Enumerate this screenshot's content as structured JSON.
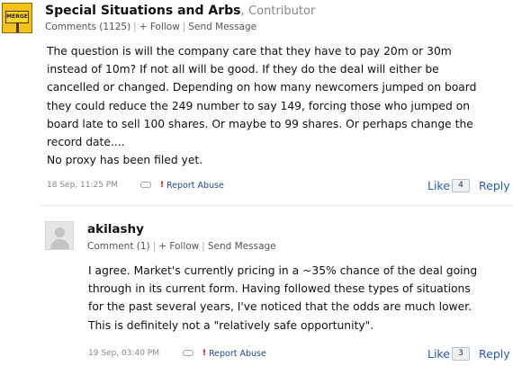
{
  "comments": [
    {
      "avatar_text": "MERGE",
      "author": "Special Situations and Arbs",
      "role_sep": ",",
      "role": "Contributor",
      "meta": {
        "comments_link": "Comments (1125)",
        "follow_link": "+ Follow",
        "message_link": "Send Message",
        "separator": "|"
      },
      "body_lines": [
        "The question is will the company care that they have to pay 20m or 30m",
        "instead of 10m? If not all will be good. If they do the deal will either be",
        "cancelled or changed. Depending on how many newcomers jumped on board",
        "they could reduce the 249 number to say 149, forcing those who jumped on",
        "board late to sell 100 shares. Or maybe to 99 shares. Or perhaps change the",
        "record date....",
        "No proxy has been filed yet."
      ],
      "timestamp": "18 Sep, 11:25 PM",
      "report_icon": "!",
      "report_label": "Report Abuse",
      "like_label": "Like",
      "like_count": "4",
      "reply_label": "Reply"
    },
    {
      "author": "akilashy",
      "meta": {
        "comments_link": "Comment (1)",
        "follow_link": "+ Follow",
        "message_link": "Send Message",
        "separator": "|"
      },
      "body_lines": [
        "I agree. Market's currently pricing in a ~35% chance of the deal going",
        "through in its current form. Having followed these types of situations",
        "for the past several years, I've noticed that the odds are much lower.",
        "This is definitely not a \"relatively safe opportunity\"."
      ],
      "timestamp": "19 Sep, 03:40 PM",
      "report_icon": "!",
      "report_label": "Report Abuse",
      "like_label": "Like",
      "like_count": "3",
      "reply_label": "Reply"
    }
  ]
}
